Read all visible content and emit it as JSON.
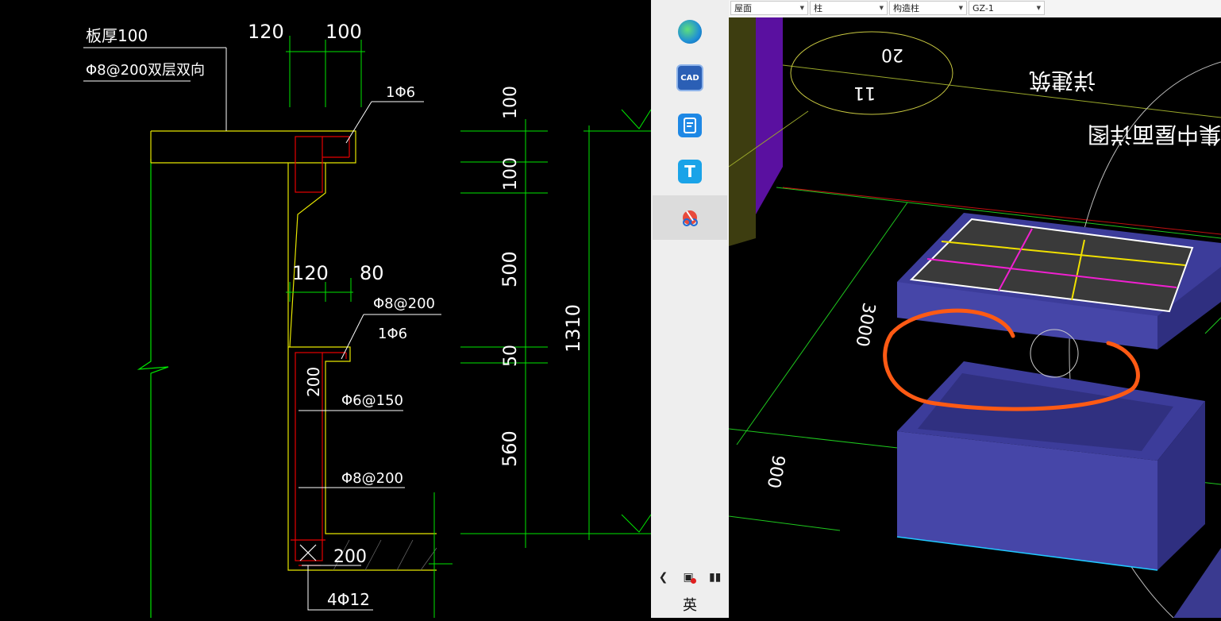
{
  "toolbar": {
    "floor": "屋面",
    "category": "柱",
    "type": "构造柱",
    "element": "GZ-1"
  },
  "cad": {
    "slab_thickness": "板厚100",
    "slab_rebar": "Φ8@200双层双向",
    "dim_top_120": "120",
    "dim_top_100": "100",
    "bar_top": "1Φ6",
    "dim_mid_120": "120",
    "dim_mid_80": "80",
    "rebar_mid": "Φ8@200",
    "bar_mid": "1Φ6",
    "dim_200_vert": "200",
    "stirrup": "Φ6@150",
    "rebar_low": "Φ8@200",
    "dim_base_200": "200",
    "bottom_bars": "4Φ12",
    "v_dims": [
      "100",
      "100",
      "500",
      "50",
      "560"
    ],
    "total_height": "1310"
  },
  "taskbar": {
    "apps": [
      {
        "name": "edge-icon",
        "label": "",
        "color": "#1f8fd6"
      },
      {
        "name": "cad-icon",
        "label": "CAD",
        "color": "#2b5fb5"
      },
      {
        "name": "doc-icon",
        "label": "",
        "color": "#1e88e5"
      },
      {
        "name": "t-icon",
        "label": "T",
        "color": "#1aa3e8"
      },
      {
        "name": "snip-icon",
        "label": "",
        "color": "#ffffff"
      }
    ],
    "ime_label": "英"
  },
  "view3d": {
    "label_20": "20",
    "label_11": "11",
    "label_text1": "详建筑",
    "label_text2": "集中屋面详图",
    "dim_3000": "3000",
    "dim_900": "900"
  },
  "colors": {
    "cad_yellow": "#e6e600",
    "cad_green": "#00e600",
    "cad_white": "#ffffff",
    "cad_red": "#e60000",
    "box_blue": "#4646a8",
    "annot_orange": "#ff5a14"
  }
}
